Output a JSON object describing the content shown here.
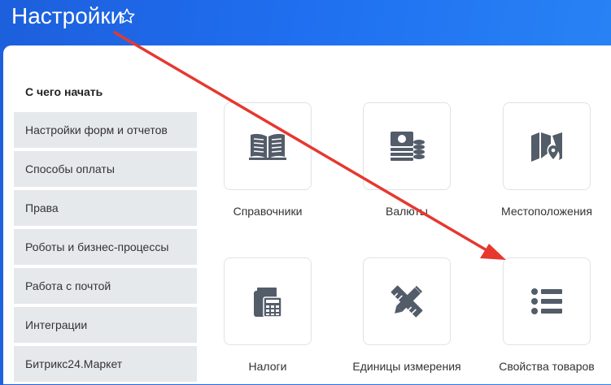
{
  "header": {
    "title": "Настройки",
    "star_icon": "star-outline-icon"
  },
  "sidebar": {
    "heading": "С чего начать",
    "items": [
      {
        "label": "Настройки форм и отчетов"
      },
      {
        "label": "Способы оплаты"
      },
      {
        "label": "Права"
      },
      {
        "label": "Роботы и бизнес-процессы"
      },
      {
        "label": "Работа с почтой"
      },
      {
        "label": "Интеграции"
      },
      {
        "label": "Битрикс24.Маркет"
      }
    ]
  },
  "tiles": [
    {
      "label": "Справочники",
      "icon": "book-icon"
    },
    {
      "label": "Валюты",
      "icon": "currency-icon"
    },
    {
      "label": "Местоположения",
      "icon": "map-pin-icon"
    },
    {
      "label": "Налоги",
      "icon": "calculator-icon"
    },
    {
      "label": "Единицы измерения",
      "icon": "ruler-pencil-icon"
    },
    {
      "label": "Свойства товаров",
      "icon": "list-icon"
    }
  ],
  "colors": {
    "accent": "#1f6ff0",
    "icon": "#535c69",
    "arrow": "#e6382f"
  }
}
